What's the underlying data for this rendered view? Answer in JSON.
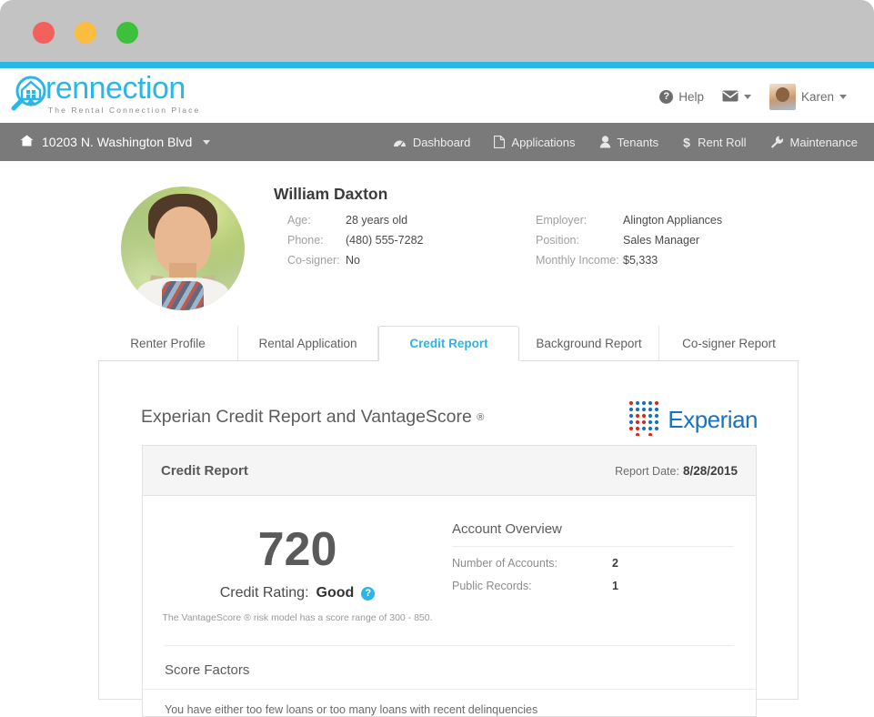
{
  "window": {
    "traffic_lights": [
      "close",
      "minimize",
      "maximize"
    ]
  },
  "header": {
    "logo_word": "rennection",
    "logo_tagline": "The Rental Connection Place",
    "help_label": "Help",
    "mail_icon": "envelope-icon",
    "user_name": "Karen"
  },
  "nav": {
    "property_address": "10203 N. Washington Blvd",
    "items": [
      {
        "label": "Dashboard",
        "icon": "dashboard-icon"
      },
      {
        "label": "Applications",
        "icon": "file-icon"
      },
      {
        "label": "Tenants",
        "icon": "person-icon"
      },
      {
        "label": "Rent Roll",
        "icon": "dollar-icon"
      },
      {
        "label": "Maintenance",
        "icon": "wrench-icon"
      }
    ]
  },
  "tenant": {
    "name": "William Daxton",
    "left_fields": [
      {
        "label": "Age:",
        "value": "28 years old"
      },
      {
        "label": "Phone:",
        "value": "(480) 555-7282"
      },
      {
        "label": "Co-signer:",
        "value": "No"
      }
    ],
    "right_fields": [
      {
        "label": "Employer:",
        "value": "Alington Appliances"
      },
      {
        "label": "Position:",
        "value": "Sales Manager"
      },
      {
        "label": "Monthly Income:",
        "value": "$5,333"
      }
    ]
  },
  "tabs": [
    {
      "label": "Renter Profile",
      "active": false
    },
    {
      "label": "Rental Application",
      "active": false
    },
    {
      "label": "Credit Report",
      "active": true
    },
    {
      "label": "Background Report",
      "active": false
    },
    {
      "label": "Co-signer Report",
      "active": false
    }
  ],
  "credit_report": {
    "page_title": "Experian Credit Report and VantageScore",
    "page_title_reg": "®",
    "brand_name": "Experian",
    "panel_title": "Credit Report",
    "report_date_label": "Report Date:",
    "report_date": "8/28/2015",
    "score": "720",
    "rating_label": "Credit Rating:",
    "rating_value": "Good",
    "help_icon": "question-mark-icon",
    "score_note": "The VantageScore ® risk model has a score range of 300 - 850.",
    "account_overview_title": "Account Overview",
    "account_overview": [
      {
        "label": "Number of Accounts:",
        "value": "2"
      },
      {
        "label": "Public Records:",
        "value": "1"
      }
    ],
    "score_factors_title": "Score Factors",
    "score_factors": [
      "You have either too few loans or too many loans with recent delinquencies"
    ]
  },
  "colors": {
    "accent_blue": "#29b6e8",
    "nav_gray": "#7a7a7a",
    "experian_blue": "#1673c4",
    "experian_red": "#e1261c"
  }
}
